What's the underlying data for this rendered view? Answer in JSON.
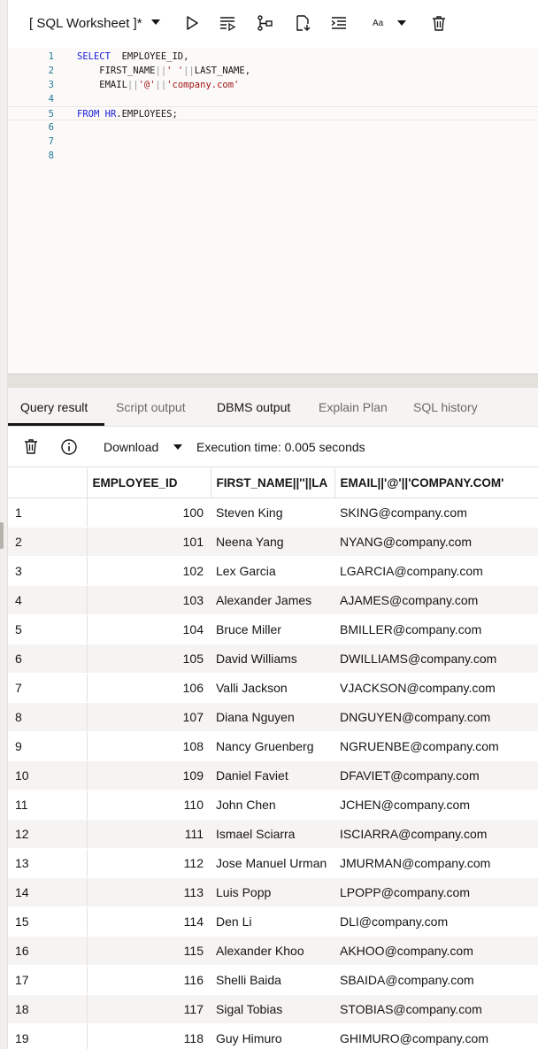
{
  "worksheet": {
    "title": "[ SQL Worksheet ]*",
    "font_size_label": "Aa"
  },
  "toolbar_icons": [
    "run-statement-icon",
    "run-script-icon",
    "explain-plan-icon",
    "autotrace-icon",
    "format-icon",
    "font-size-icon",
    "clear-icon"
  ],
  "editor": {
    "line_numbers": [
      "1",
      "2",
      "3",
      "4",
      "5",
      "6",
      "7",
      "8"
    ],
    "lines": [
      [
        {
          "t": "kw",
          "v": "SELECT"
        },
        {
          "t": "plain",
          "v": "  EMPLOYEE_ID,"
        }
      ],
      [
        {
          "t": "plain",
          "v": "    FIRST_NAME"
        },
        {
          "t": "op",
          "v": "||"
        },
        {
          "t": "str",
          "v": "' '"
        },
        {
          "t": "op",
          "v": "||"
        },
        {
          "t": "plain",
          "v": "LAST_NAME,"
        }
      ],
      [
        {
          "t": "plain",
          "v": "    EMAIL"
        },
        {
          "t": "op",
          "v": "||"
        },
        {
          "t": "str",
          "v": "'@'"
        },
        {
          "t": "op",
          "v": "||"
        },
        {
          "t": "str",
          "v": "'company.com'"
        }
      ],
      [],
      [
        {
          "t": "kw",
          "v": "FROM"
        },
        {
          "t": "plain",
          "v": " "
        },
        {
          "t": "kw",
          "v": "HR"
        },
        {
          "t": "plain",
          "v": ".EMPLOYEES;"
        }
      ],
      [],
      [],
      []
    ]
  },
  "result_tabs": [
    {
      "label": "Query result",
      "active": true
    },
    {
      "label": "Script output",
      "active": false
    },
    {
      "label": "DBMS output",
      "active": false
    },
    {
      "label": "Explain Plan",
      "active": false
    },
    {
      "label": "SQL history",
      "active": false
    }
  ],
  "result_toolbar": {
    "download_label": "Download",
    "execution_time": "Execution time: 0.005 seconds"
  },
  "grid": {
    "columns": [
      "",
      "EMPLOYEE_ID",
      "FIRST_NAME||''||LA",
      "EMAIL||'@'||'COMPANY.COM'"
    ],
    "rows": [
      [
        "1",
        "100",
        "Steven King",
        "SKING@company.com"
      ],
      [
        "2",
        "101",
        "Neena Yang",
        "NYANG@company.com"
      ],
      [
        "3",
        "102",
        "Lex Garcia",
        "LGARCIA@company.com"
      ],
      [
        "4",
        "103",
        "Alexander James",
        "AJAMES@company.com"
      ],
      [
        "5",
        "104",
        "Bruce Miller",
        "BMILLER@company.com"
      ],
      [
        "6",
        "105",
        "David Williams",
        "DWILLIAMS@company.com"
      ],
      [
        "7",
        "106",
        "Valli Jackson",
        "VJACKSON@company.com"
      ],
      [
        "8",
        "107",
        "Diana Nguyen",
        "DNGUYEN@company.com"
      ],
      [
        "9",
        "108",
        "Nancy Gruenberg",
        "NGRUENBE@company.com"
      ],
      [
        "10",
        "109",
        "Daniel Faviet",
        "DFAVIET@company.com"
      ],
      [
        "11",
        "110",
        "John Chen",
        "JCHEN@company.com"
      ],
      [
        "12",
        "111",
        "Ismael Sciarra",
        "ISCIARRA@company.com"
      ],
      [
        "13",
        "112",
        "Jose Manuel Urman",
        "JMURMAN@company.com"
      ],
      [
        "14",
        "113",
        "Luis Popp",
        "LPOPP@company.com"
      ],
      [
        "15",
        "114",
        "Den Li",
        "DLI@company.com"
      ],
      [
        "16",
        "115",
        "Alexander Khoo",
        "AKHOO@company.com"
      ],
      [
        "17",
        "116",
        "Shelli Baida",
        "SBAIDA@company.com"
      ],
      [
        "18",
        "117",
        "Sigal Tobias",
        "STOBIAS@company.com"
      ],
      [
        "19",
        "118",
        "Guy Himuro",
        "GHIMURO@company.com"
      ]
    ]
  }
}
